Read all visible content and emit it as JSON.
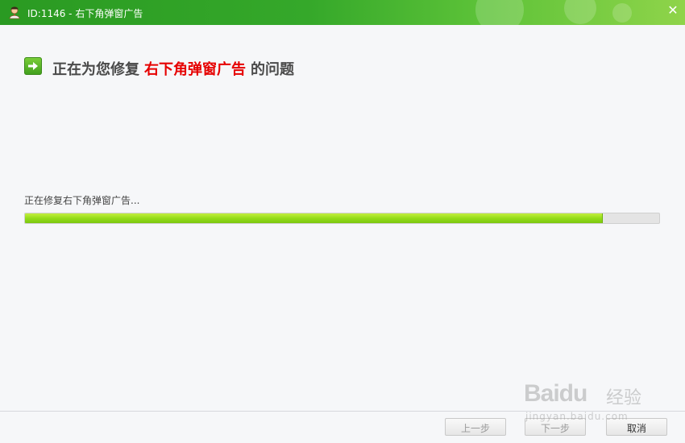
{
  "window": {
    "title": "ID:1146 - 右下角弹窗广告",
    "icon": "user-avatar-icon",
    "close_symbol": "✕",
    "accent_color": "#35a82a"
  },
  "heading": {
    "icon": "arrow-right-icon",
    "prefix": "正在为您修复",
    "highlight": "右下角弹窗广告",
    "suffix": "的问题",
    "highlight_color": "#e60000"
  },
  "progress": {
    "status_text": "正在修复右下角弹窗广告...",
    "percent": 91
  },
  "footer": {
    "prev_label": "上一步",
    "next_label": "下一步",
    "cancel_label": "取消"
  },
  "watermark": {
    "logo": "Baidu",
    "text": "经验",
    "url": "jingyan.baidu.com"
  }
}
